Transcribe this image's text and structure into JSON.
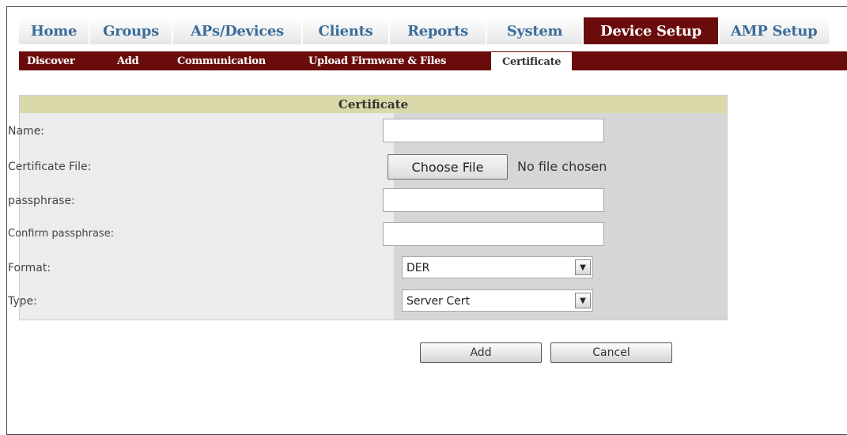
{
  "main_nav": [
    {
      "label": "Home"
    },
    {
      "label": "Groups"
    },
    {
      "label": "APs/Devices"
    },
    {
      "label": "Clients"
    },
    {
      "label": "Reports"
    },
    {
      "label": "System"
    },
    {
      "label": "Device Setup",
      "active": true
    },
    {
      "label": "AMP Setup"
    }
  ],
  "sub_nav": [
    {
      "label": "Discover"
    },
    {
      "label": "Add"
    },
    {
      "label": "Communication"
    },
    {
      "label": "Upload Firmware & Files"
    },
    {
      "label": "Certificate",
      "active": true
    }
  ],
  "form": {
    "title": "Certificate",
    "name_label": "Name:",
    "name_value": "",
    "file_label": "Certificate File:",
    "choose_file_label": "Choose File",
    "no_file_text": "No file chosen",
    "passphrase_label": "passphrase:",
    "passphrase_value": "",
    "confirm_label": "Confirm passphrase:",
    "confirm_value": "",
    "format_label": "Format:",
    "format_value": "DER",
    "type_label": "Type:",
    "type_value": "Server Cert"
  },
  "buttons": {
    "add": "Add",
    "cancel": "Cancel"
  },
  "colors": {
    "nav_active": "#6b0c0c",
    "nav_text": "#3a6d9a",
    "header_bg": "#d9d9a9"
  }
}
